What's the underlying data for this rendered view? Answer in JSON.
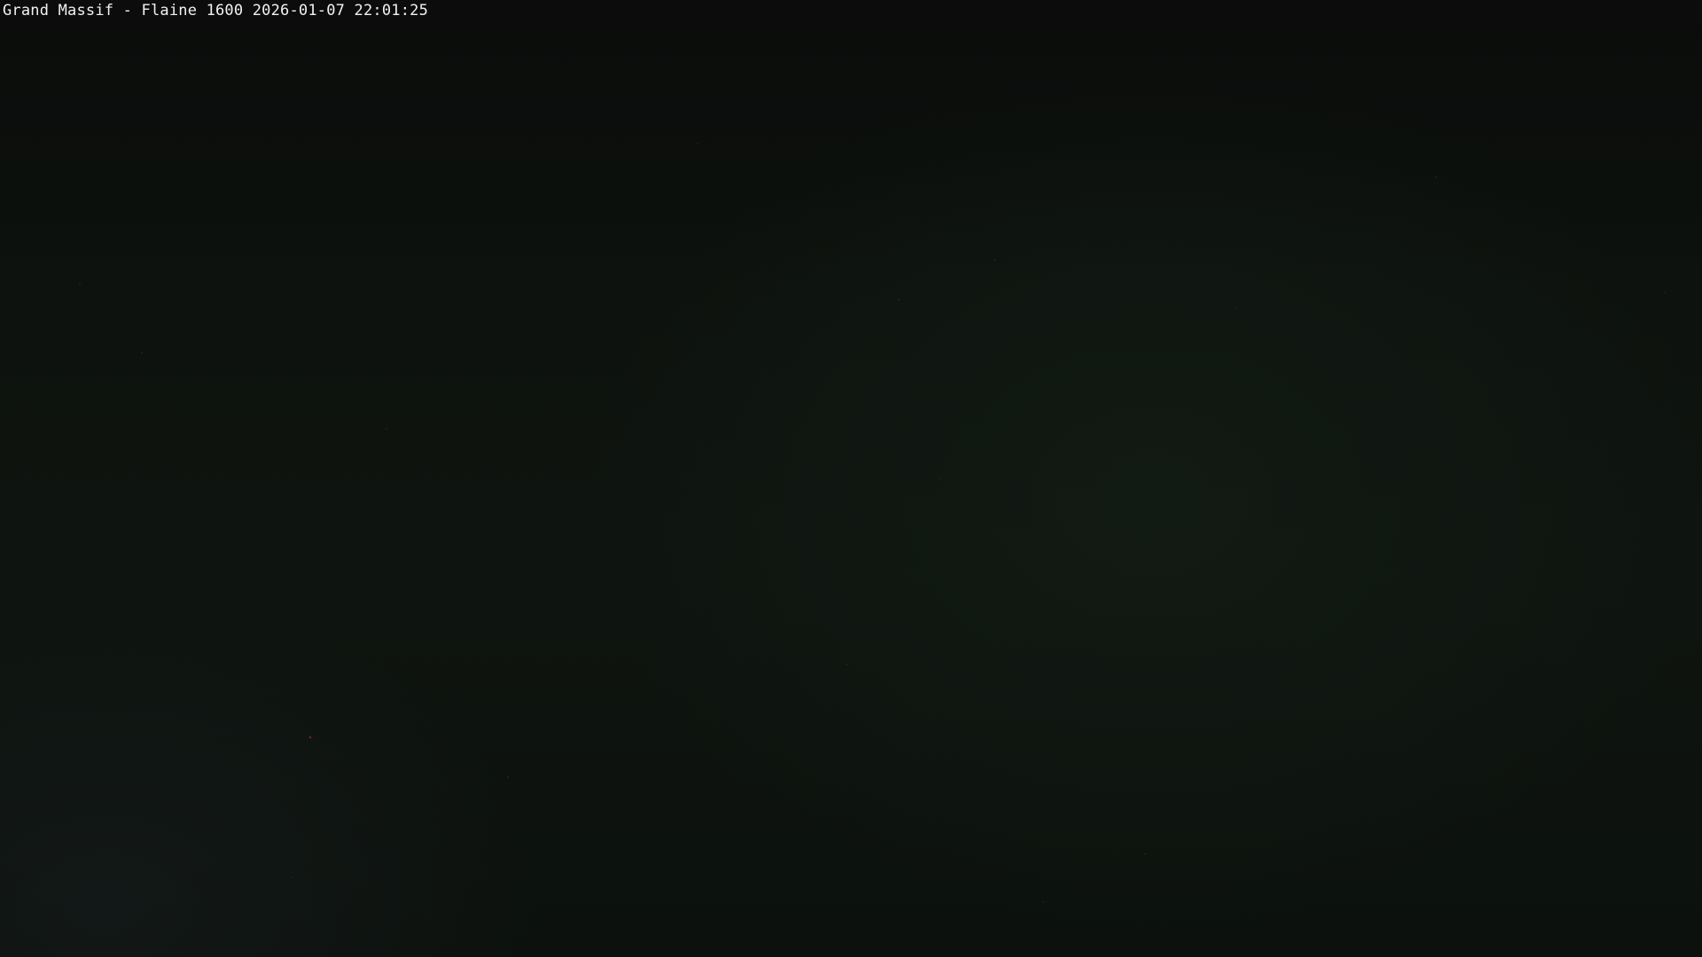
{
  "overlay": {
    "caption": "Grand Massif - Flaine 1600 2026-01-07 22:01:25"
  },
  "colors": {
    "sky_dark": "#0a0c0a",
    "sky_mid": "#0e140f",
    "text": "#f2f2f2"
  }
}
